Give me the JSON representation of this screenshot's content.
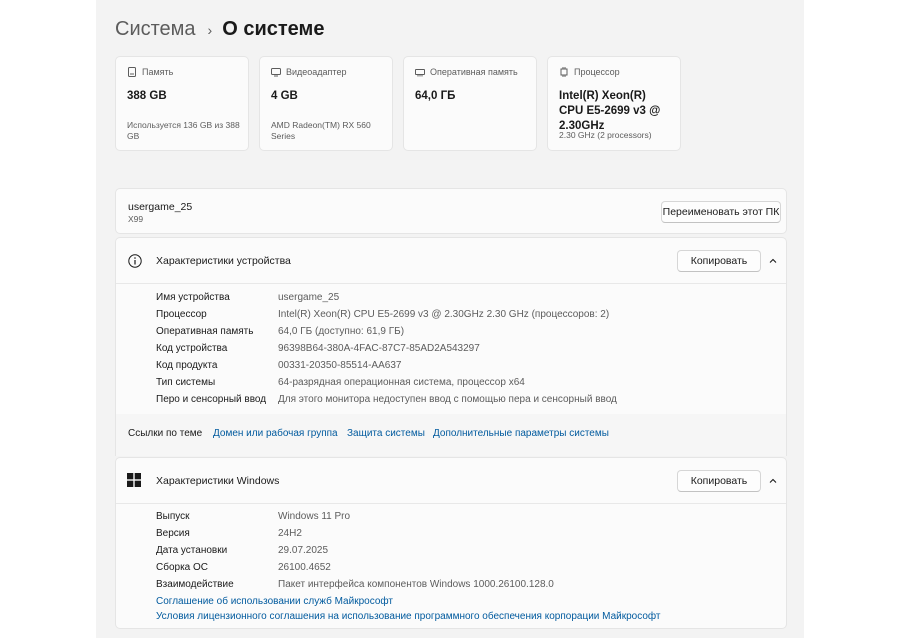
{
  "breadcrumb": {
    "parent": "Система",
    "separator": "›",
    "current": "О системе"
  },
  "spec_cards": [
    {
      "icon": "storage-icon",
      "label": "Память",
      "value": "388 GB",
      "sub": "Используется 136 GB из 388 GB"
    },
    {
      "icon": "gpu-icon",
      "label": "Видеоадаптер",
      "value": "4 GB",
      "sub": "AMD Radeon(TM) RX 560 Series"
    },
    {
      "icon": "ram-icon",
      "label": "Оперативная память",
      "value": "64,0 ГБ",
      "sub": ""
    },
    {
      "icon": "cpu-icon",
      "label": "Процессор",
      "value": "Intel(R) Xeon(R) CPU E5-2699 v3 @ 2.30GHz",
      "sub": "2.30 GHz (2 processors)"
    }
  ],
  "pc": {
    "name": "usergame_25",
    "model": "X99",
    "rename_label": "Переименовать этот ПК"
  },
  "device_specs": {
    "title": "Характеристики устройства",
    "copy_label": "Копировать",
    "rows": [
      {
        "label": "Имя устройства",
        "value": "usergame_25"
      },
      {
        "label": "Процессор",
        "value": "Intel(R) Xeon(R) CPU E5-2699 v3 @ 2.30GHz   2.30 GHz (процессоров: 2)"
      },
      {
        "label": "Оперативная память",
        "value": "64,0 ГБ (доступно: 61,9 ГБ)"
      },
      {
        "label": "Код устройства",
        "value": "96398B64-380A-4FAC-87C7-85AD2A543297"
      },
      {
        "label": "Код продукта",
        "value": "00331-20350-85514-AA637"
      },
      {
        "label": "Тип системы",
        "value": "64-разрядная операционная система, процессор x64"
      },
      {
        "label": "Перо и сенсорный ввод",
        "value": "Для этого монитора недоступен ввод с помощью пера и сенсорный ввод"
      }
    ]
  },
  "related": {
    "label": "Ссылки по теме",
    "links": [
      "Домен или рабочая группа",
      "Защита системы",
      "Дополнительные параметры системы"
    ]
  },
  "windows_specs": {
    "title": "Характеристики Windows",
    "copy_label": "Копировать",
    "rows": [
      {
        "label": "Выпуск",
        "value": "Windows 11 Pro"
      },
      {
        "label": "Версия",
        "value": "24H2"
      },
      {
        "label": "Дата установки",
        "value": "29.07.2025"
      },
      {
        "label": "Сборка ОС",
        "value": "26100.4652"
      },
      {
        "label": "Взаимодействие",
        "value": "Пакет интерфейса компонентов Windows 1000.26100.128.0"
      }
    ],
    "links": [
      "Соглашение об использовании служб Майкрософт",
      "Условия лицензионного соглашения на использование программного обеспечения корпорации Майкрософт"
    ]
  },
  "colors": {
    "window_bg": "#f3f3f3",
    "card_bg": "#fbfbfb",
    "link": "#005a9e",
    "secondary_text": "#5c5c5c"
  }
}
